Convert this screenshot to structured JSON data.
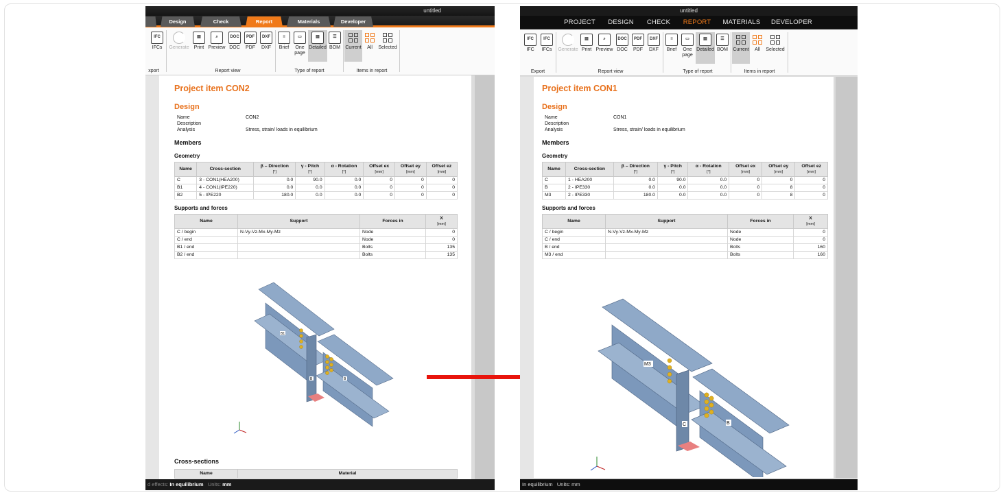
{
  "left": {
    "title": "untitled",
    "tabs": [
      {
        "label": "Design",
        "active": false
      },
      {
        "label": "Check",
        "active": false
      },
      {
        "label": "Report",
        "active": true
      },
      {
        "label": "Materials",
        "active": false
      },
      {
        "label": "Developer",
        "active": false
      }
    ],
    "ribbon": {
      "ifcs_label": "IFCs",
      "generate": "Generate",
      "print": "Print",
      "preview": "Preview",
      "doc": "DOC",
      "pdf": "PDF",
      "dxf": "DXF",
      "brief": "Brief",
      "one_page": "One page",
      "detailed": "Detailed",
      "bom": "BOM",
      "current": "Current",
      "all": "All",
      "selected": "Selected",
      "groups": {
        "export": "xport",
        "report_view": "Report view",
        "type_of_report": "Type of report",
        "items_in_report": "Items in report"
      }
    },
    "report": {
      "title": "Project item CON2",
      "design_heading": "Design",
      "design_rows": [
        [
          "Name",
          "CON2"
        ],
        [
          "Description",
          ""
        ],
        [
          "Analysis",
          "Stress, strain/ loads in equilibrium"
        ]
      ],
      "members_heading": "Members",
      "geometry_heading": "Geometry",
      "geometry_headers": [
        [
          "Name",
          ""
        ],
        [
          "Cross-section",
          ""
        ],
        [
          "β – Direction",
          "[°]"
        ],
        [
          "γ - Pitch",
          "[°]"
        ],
        [
          "α - Rotation",
          "[°]"
        ],
        [
          "Offset ex",
          "[mm]"
        ],
        [
          "Offset ey",
          "[mm]"
        ],
        [
          "Offset ez",
          "[mm]"
        ]
      ],
      "geometry_rows": [
        [
          "C",
          "3 - CON1(HEA200)",
          "0.0",
          "90.0",
          "0.0",
          "0",
          "0",
          "0"
        ],
        [
          "B1",
          "4 - CON1(IPE220)",
          "0.0",
          "0.0",
          "0.0",
          "0",
          "0",
          "0"
        ],
        [
          "B2",
          "5 - IPE220",
          "180.0",
          "0.0",
          "0.0",
          "0",
          "0",
          "0"
        ]
      ],
      "supports_heading": "Supports and forces",
      "supports_headers": [
        [
          "Name",
          ""
        ],
        [
          "Support",
          ""
        ],
        [
          "Forces in",
          ""
        ],
        [
          "X",
          "[mm]"
        ]
      ],
      "supports_rows": [
        [
          "C / begin",
          "N-Vy-Vz-Mx-My-Mz",
          "Node",
          "0"
        ],
        [
          "C / end",
          "",
          "Node",
          "0"
        ],
        [
          "B1 / end",
          "",
          "Bolts",
          "135"
        ],
        [
          "B2 / end",
          "",
          "Bolts",
          "135"
        ]
      ],
      "cross_heading": "Cross-sections",
      "cross_headers": [
        "Name",
        "Material"
      ],
      "model_labels": [
        "B1",
        "B",
        "B"
      ]
    },
    "status": {
      "prefix": "d effects:",
      "state": "In equilibrium",
      "units_label": "Units:",
      "units": "mm"
    }
  },
  "right": {
    "title": "untitled",
    "tabs": [
      {
        "label": "PROJECT",
        "active": false
      },
      {
        "label": "DESIGN",
        "active": false
      },
      {
        "label": "CHECK",
        "active": false
      },
      {
        "label": "REPORT",
        "active": true
      },
      {
        "label": "MATERIALS",
        "active": false
      },
      {
        "label": "DEVELOPER",
        "active": false
      }
    ],
    "ribbon": {
      "ifc": "IFC",
      "ifcs": "IFCs",
      "generate": "Generate",
      "print": "Print",
      "preview": "Preview",
      "doc": "DOC",
      "pdf": "PDF",
      "dxf": "DXF",
      "brief": "Brief",
      "one_page": "One page",
      "detailed": "Detailed",
      "bom": "BOM",
      "current": "Current",
      "all": "All",
      "selected": "Selected",
      "groups": {
        "export": "Export",
        "report_view": "Report view",
        "type_of_report": "Type of report",
        "items_in_report": "Items in report"
      }
    },
    "report": {
      "title": "Project item CON1",
      "design_heading": "Design",
      "design_rows": [
        [
          "Name",
          "CON1"
        ],
        [
          "Description",
          ""
        ],
        [
          "Analysis",
          "Stress, strain/ loads in equilibrium"
        ]
      ],
      "members_heading": "Members",
      "geometry_heading": "Geometry",
      "geometry_headers": [
        [
          "Name",
          ""
        ],
        [
          "Cross-section",
          ""
        ],
        [
          "β – Direction",
          "[°]"
        ],
        [
          "γ - Pitch",
          "[°]"
        ],
        [
          "α - Rotation",
          "[°]"
        ],
        [
          "Offset ex",
          "[mm]"
        ],
        [
          "Offset ey",
          "[mm]"
        ],
        [
          "Offset ez",
          "[mm]"
        ]
      ],
      "geometry_rows": [
        [
          "C",
          "1 - HEA200",
          "0.0",
          "90.0",
          "0.0",
          "0",
          "0",
          "0"
        ],
        [
          "B",
          "2 - IPE330",
          "0.0",
          "0.0",
          "0.0",
          "0",
          "8",
          "0"
        ],
        [
          "M3",
          "2 - IPE330",
          "180.0",
          "0.0",
          "0.0",
          "0",
          "8",
          "0"
        ]
      ],
      "supports_heading": "Supports and forces",
      "supports_headers": [
        [
          "Name",
          ""
        ],
        [
          "Support",
          ""
        ],
        [
          "Forces in",
          ""
        ],
        [
          "X",
          "[mm]"
        ]
      ],
      "supports_rows": [
        [
          "C / begin",
          "N-Vy-Vz-Mx-My-Mz",
          "Node",
          "0"
        ],
        [
          "C / end",
          "",
          "Node",
          "0"
        ],
        [
          "B / end",
          "",
          "Bolts",
          "160"
        ],
        [
          "M3 / end",
          "",
          "Bolts",
          "160"
        ]
      ],
      "model_labels": [
        "M3",
        "C",
        "B"
      ]
    },
    "status": {
      "state": "In equilibrium",
      "units_label": "Units:",
      "units": "mm"
    }
  },
  "colors": {
    "accent": "#f07a1a",
    "arrow": "#e8140c",
    "steel": "#7f9bbd",
    "bolt": "#e0b020"
  }
}
